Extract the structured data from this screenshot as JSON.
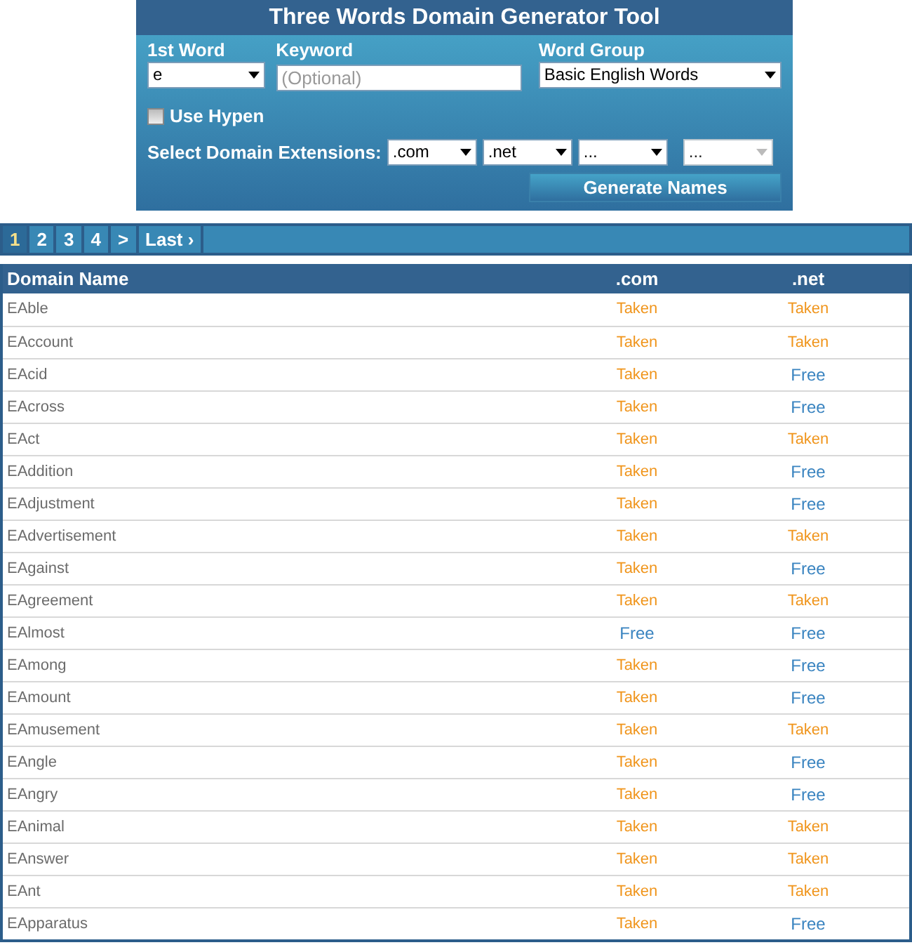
{
  "form": {
    "title": "Three Words Domain Generator Tool",
    "first_word": {
      "label": "1st Word",
      "value": "e"
    },
    "keyword": {
      "label": "Keyword",
      "placeholder": "(Optional)"
    },
    "word_group": {
      "label": "Word Group",
      "value": "Basic English Words"
    },
    "use_hyphen": {
      "label": "Use Hypen",
      "checked": false
    },
    "extensions": {
      "label": "Select Domain Extensions:",
      "selects": [
        {
          "value": ".com",
          "disabled": false
        },
        {
          "value": ".net",
          "disabled": false
        },
        {
          "value": "...",
          "disabled": false
        },
        {
          "value": "...",
          "disabled": true
        }
      ]
    },
    "button": "Generate Names"
  },
  "pagination": [
    {
      "label": "1",
      "selected": true
    },
    {
      "label": "2",
      "selected": false
    },
    {
      "label": "3",
      "selected": false
    },
    {
      "label": "4",
      "selected": false
    },
    {
      "label": ">",
      "selected": false
    },
    {
      "label": "Last ›",
      "selected": false
    }
  ],
  "table": {
    "columns": [
      "Domain Name",
      ".com",
      ".net"
    ],
    "rows": [
      {
        "cells": [
          {
            "text": "EAble"
          },
          {
            "text": "Taken",
            "available": false
          },
          {
            "text": "Taken",
            "available": false
          }
        ]
      },
      {
        "cells": [
          {
            "text": "EAccount"
          },
          {
            "text": "Taken",
            "available": false
          },
          {
            "text": "Taken",
            "available": false
          }
        ]
      },
      {
        "cells": [
          {
            "text": "EAcid"
          },
          {
            "text": "Taken",
            "available": false
          },
          {
            "text": "Free",
            "available": true
          }
        ]
      },
      {
        "cells": [
          {
            "text": "EAcross"
          },
          {
            "text": "Taken",
            "available": false
          },
          {
            "text": "Free",
            "available": true
          }
        ]
      },
      {
        "cells": [
          {
            "text": "EAct"
          },
          {
            "text": "Taken",
            "available": false
          },
          {
            "text": "Taken",
            "available": false
          }
        ]
      },
      {
        "cells": [
          {
            "text": "EAddition"
          },
          {
            "text": "Taken",
            "available": false
          },
          {
            "text": "Free",
            "available": true
          }
        ]
      },
      {
        "cells": [
          {
            "text": "EAdjustment"
          },
          {
            "text": "Taken",
            "available": false
          },
          {
            "text": "Free",
            "available": true
          }
        ]
      },
      {
        "cells": [
          {
            "text": "EAdvertisement"
          },
          {
            "text": "Taken",
            "available": false
          },
          {
            "text": "Taken",
            "available": false
          }
        ]
      },
      {
        "cells": [
          {
            "text": "EAgainst"
          },
          {
            "text": "Taken",
            "available": false
          },
          {
            "text": "Free",
            "available": true
          }
        ]
      },
      {
        "cells": [
          {
            "text": "EAgreement"
          },
          {
            "text": "Taken",
            "available": false
          },
          {
            "text": "Taken",
            "available": false
          }
        ]
      },
      {
        "cells": [
          {
            "text": "EAlmost"
          },
          {
            "text": "Free",
            "available": true
          },
          {
            "text": "Free",
            "available": true
          }
        ]
      },
      {
        "cells": [
          {
            "text": "EAmong"
          },
          {
            "text": "Taken",
            "available": false
          },
          {
            "text": "Free",
            "available": true
          }
        ]
      },
      {
        "cells": [
          {
            "text": "EAmount"
          },
          {
            "text": "Taken",
            "available": false
          },
          {
            "text": "Free",
            "available": true
          }
        ]
      },
      {
        "cells": [
          {
            "text": "EAmusement"
          },
          {
            "text": "Taken",
            "available": false
          },
          {
            "text": "Taken",
            "available": false
          }
        ]
      },
      {
        "cells": [
          {
            "text": "EAngle"
          },
          {
            "text": "Taken",
            "available": false
          },
          {
            "text": "Free",
            "available": true
          }
        ]
      },
      {
        "cells": [
          {
            "text": "EAngry"
          },
          {
            "text": "Taken",
            "available": false
          },
          {
            "text": "Free",
            "available": true
          }
        ]
      },
      {
        "cells": [
          {
            "text": "EAnimal"
          },
          {
            "text": "Taken",
            "available": false
          },
          {
            "text": "Taken",
            "available": false
          }
        ]
      },
      {
        "cells": [
          {
            "text": "EAnswer"
          },
          {
            "text": "Taken",
            "available": false
          },
          {
            "text": "Taken",
            "available": false
          }
        ]
      },
      {
        "cells": [
          {
            "text": "EAnt"
          },
          {
            "text": "Taken",
            "available": false
          },
          {
            "text": "Taken",
            "available": false
          }
        ]
      },
      {
        "cells": [
          {
            "text": "EApparatus"
          },
          {
            "text": "Taken",
            "available": false
          },
          {
            "text": "Free",
            "available": true
          }
        ]
      }
    ]
  }
}
